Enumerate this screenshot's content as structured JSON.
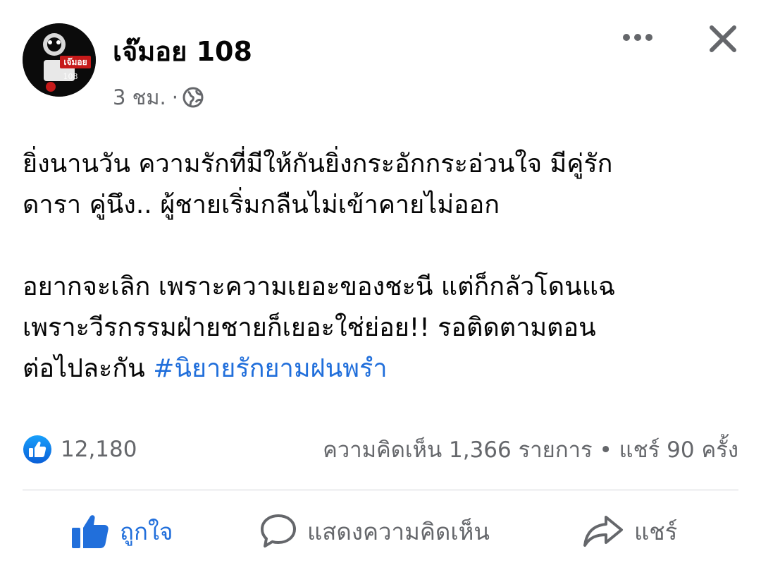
{
  "post": {
    "author": "เจ๊มอย 108",
    "time": "3 ชม.",
    "separator": "·",
    "privacy_icon": "globe-icon",
    "avatar_text": "เจ๊มอย",
    "avatar_number": "108",
    "paragraph1_line1": "ยิ่งนานวัน ความรักที่มีให้กันยิ่งกระอักกระอ่วนใจ มีคู่รัก",
    "paragraph1_line2": "ดารา คู่นึง.. ผู้ชายเริ่มกลืนไม่เข้าคายไม่ออก",
    "paragraph2_line1": "อยากจะเลิก เพราะความเยอะของชะนี แต่ก็กลัวโดนแฉ",
    "paragraph2_line2": "เพราะวีรกรรมฝ่ายชายก็เยอะใช่ย่อย!! รอติดตามตอน",
    "paragraph2_line3": "ต่อไปละกัน ",
    "hashtag": "#นิยายรักยามฝนพรำ"
  },
  "stats": {
    "likes": "12,180",
    "comments_shares": "ความคิดเห็น 1,366 รายการ • แชร์ 90 ครั้ง"
  },
  "actions": {
    "like_label": "ถูกใจ",
    "comment_label": "แสดงความคิดเห็น",
    "share_label": "แชร์"
  },
  "colors": {
    "accent": "#216fdb",
    "secondary_text": "#65676b",
    "primary_text": "#050505"
  }
}
